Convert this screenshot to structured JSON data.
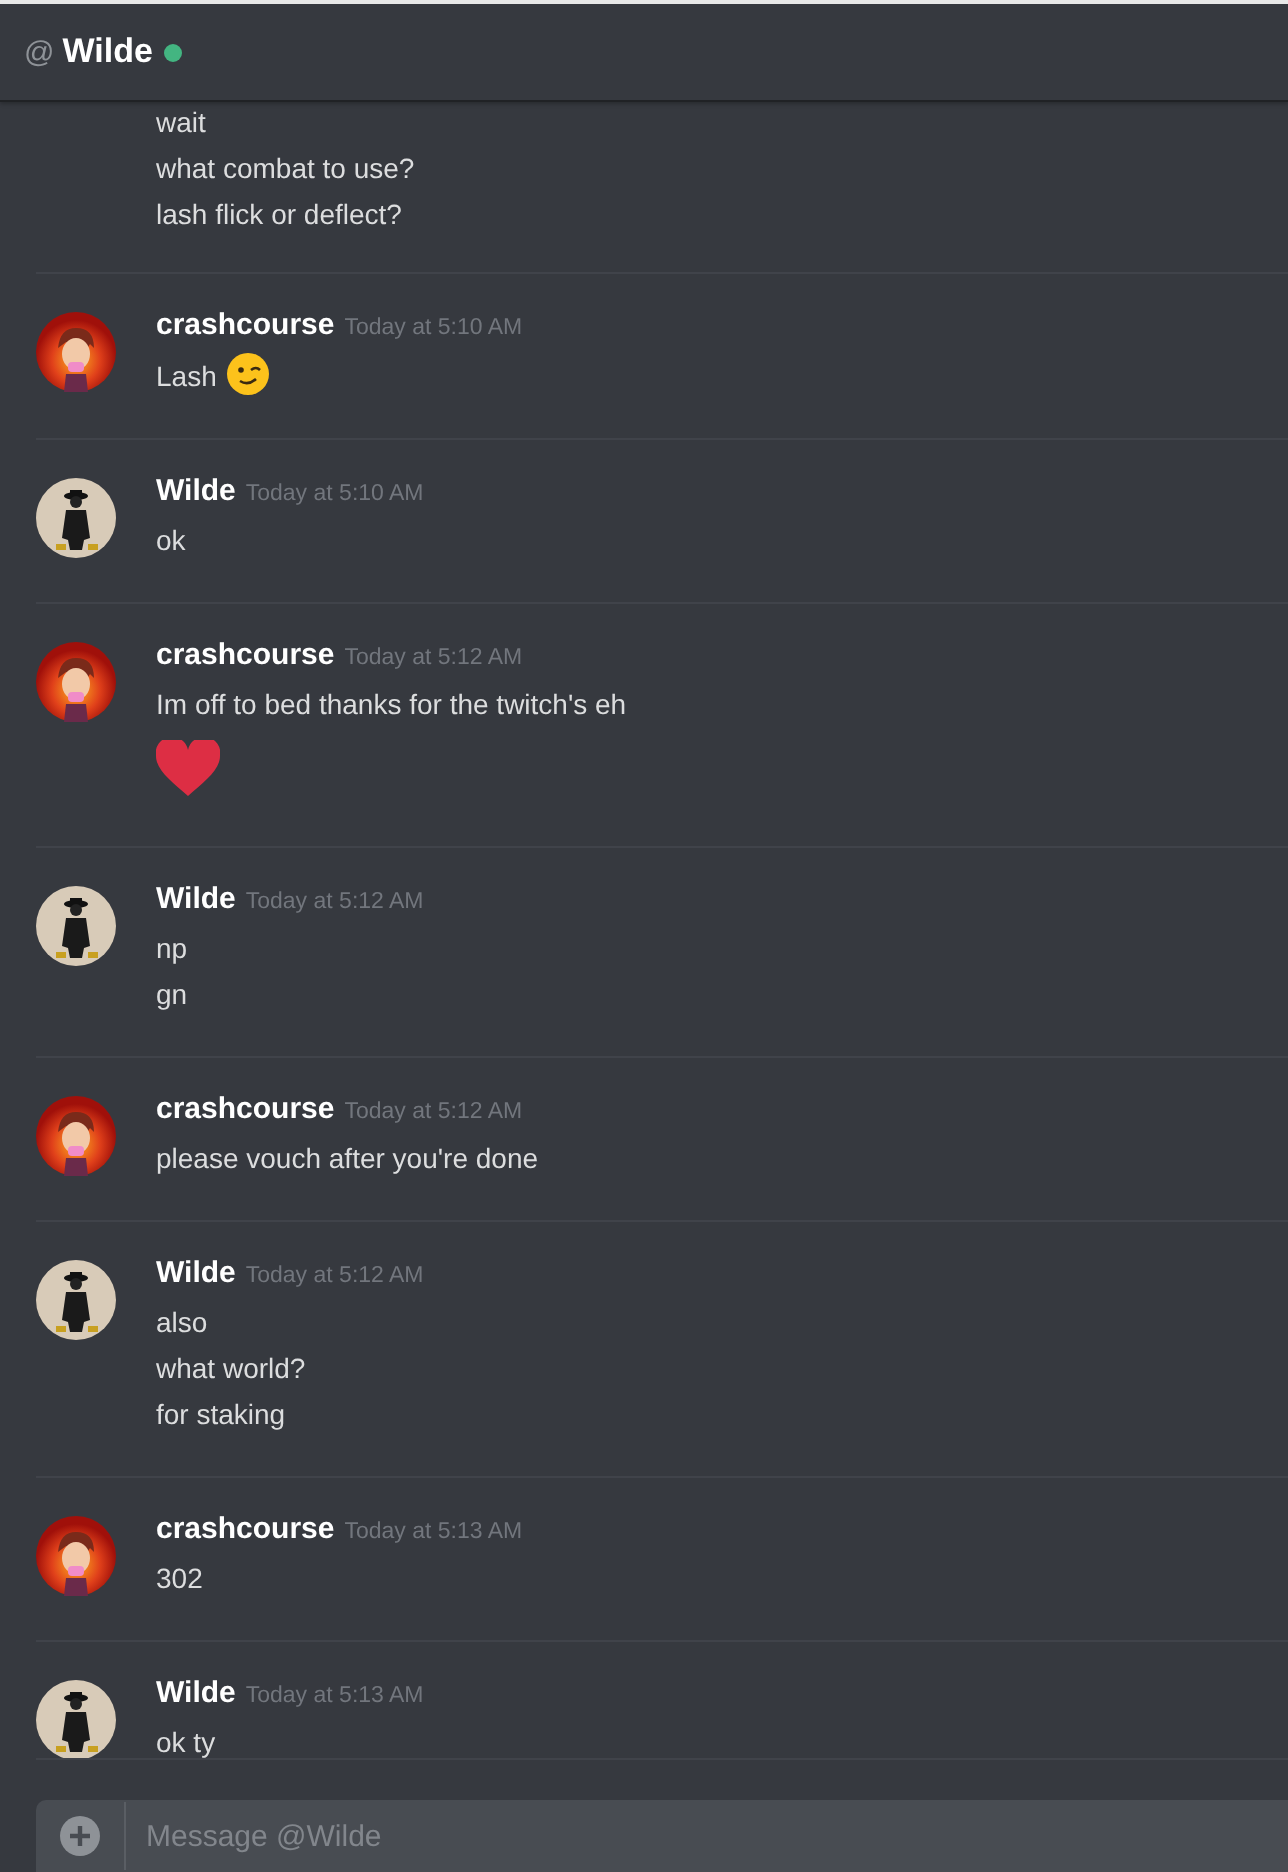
{
  "header": {
    "symbol": "@",
    "title": "Wilde",
    "online": true
  },
  "messages": [
    {
      "lines": [
        "wait",
        "what combat to use?",
        "lash flick or deflect?"
      ]
    },
    {
      "author": "crashcourse",
      "avatar": {
        "kind": "flame"
      },
      "time": "Today at 5:10 AM",
      "lines": [
        "Lash"
      ],
      "emoji": {
        "kind": "wink"
      }
    },
    {
      "author": "Wilde",
      "avatar": {
        "kind": "figure"
      },
      "time": "Today at 5:10 AM",
      "lines": [
        "ok"
      ]
    },
    {
      "author": "crashcourse",
      "avatar": {
        "kind": "flame"
      },
      "time": "Today at 5:12 AM",
      "lines": [
        "Im off to bed thanks for the twitch's eh"
      ],
      "emoji": {
        "kind": "heart"
      }
    },
    {
      "author": "Wilde",
      "avatar": {
        "kind": "figure"
      },
      "time": "Today at 5:12 AM",
      "lines": [
        "np",
        "gn"
      ]
    },
    {
      "author": "crashcourse",
      "avatar": {
        "kind": "flame"
      },
      "time": "Today at 5:12 AM",
      "lines": [
        "please vouch after you're done"
      ]
    },
    {
      "author": "Wilde",
      "avatar": {
        "kind": "figure"
      },
      "time": "Today at 5:12 AM",
      "lines": [
        "also",
        "what world?",
        "for staking"
      ]
    },
    {
      "author": "crashcourse",
      "avatar": {
        "kind": "flame"
      },
      "time": "Today at 5:13 AM",
      "lines": [
        "302"
      ]
    },
    {
      "author": "Wilde",
      "avatar": {
        "kind": "figure"
      },
      "time": "Today at 5:13 AM",
      "lines": [
        "ok ty"
      ]
    }
  ],
  "composer": {
    "placeholder": "Message @Wilde"
  }
}
